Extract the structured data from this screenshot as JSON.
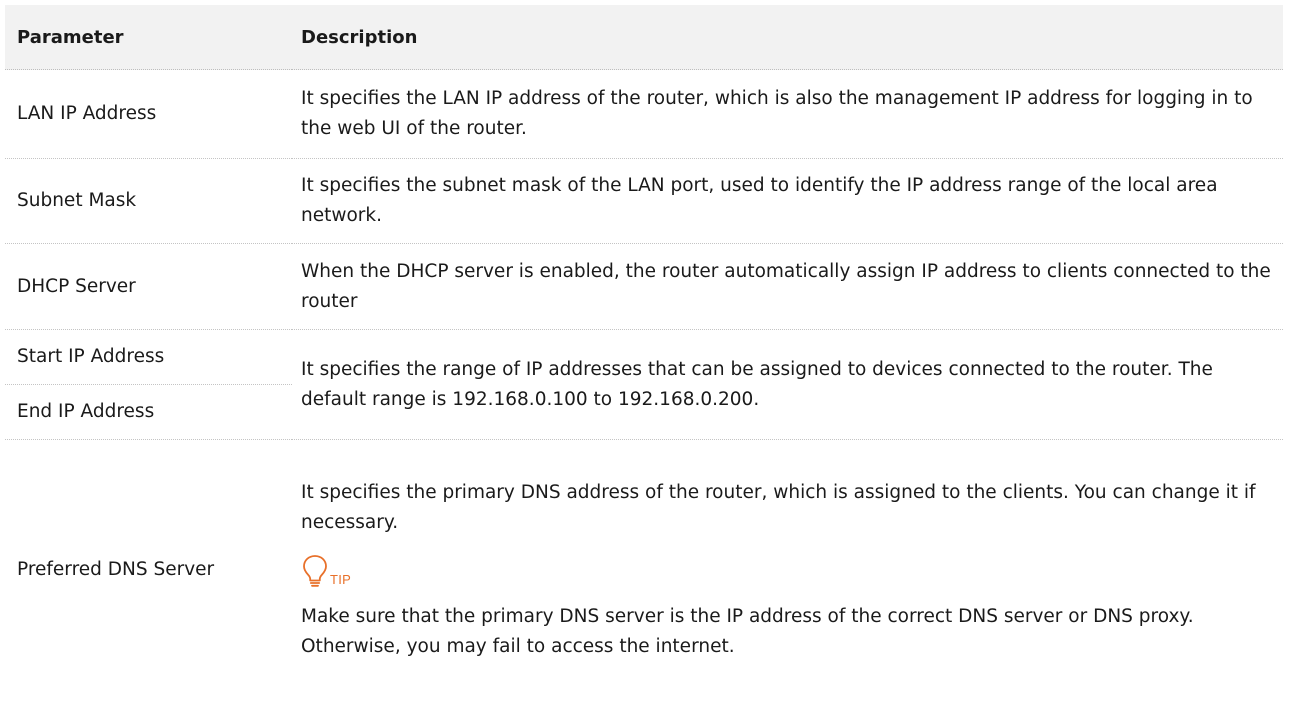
{
  "table": {
    "headers": {
      "parameter": "Parameter",
      "description": "Description"
    },
    "rows": [
      {
        "parameter": "LAN IP Address",
        "description": "It specifies the LAN IP address of the router, which is also the management IP address for logging in to the web UI of the router."
      },
      {
        "parameter": "Subnet Mask",
        "description": "It specifies the subnet mask of the LAN port, used to identify the IP address range of the local area network."
      },
      {
        "parameter": "DHCP Server",
        "description": "When the DHCP server is enabled, the router automatically assign IP address to clients connected to the router"
      },
      {
        "parameter": "Start IP Address",
        "description": "It specifies the range of IP addresses that can be assigned to devices connected to the router. The default range is 192.168.0.100 to 192.168.0.200."
      },
      {
        "parameter": "End IP Address"
      },
      {
        "parameter": "Preferred DNS Server",
        "description": "It specifies the primary DNS address of the router, which is assigned to the clients. You can change it if necessary.",
        "tip_label": "TIP",
        "tip_text": "Make sure that the primary DNS server is the IP address of the correct DNS server or DNS proxy. Otherwise, you may fail to access the internet."
      }
    ]
  },
  "colors": {
    "header_background": "#f2f2f2",
    "tip_accent": "#e8702a",
    "text": "#1a1a1a"
  },
  "icons": {
    "tip": "lightbulb-icon"
  }
}
